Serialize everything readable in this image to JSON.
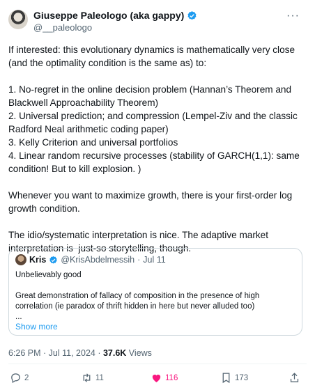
{
  "author": {
    "name": "Giuseppe Paleologo (aka gappy)",
    "handle": "@__paleologo"
  },
  "more_icon": "more-dots-icon",
  "body_text": "If interested: this evolutionary dynamics is mathematically very close\n(and the optimality condition is the same as) to:\n\n1. No-regret in the online decision problem (Hannan’s Theorem and\nBlackwell Approachability Theorem)\n2. Universal prediction; and compression (Lempel-Ziv and the classic\nRadford Neal arithmetic coding paper)\n3. Kelly Criterion and universal portfolios\n4. Linear random recursive processes (stability of GARCH(1,1): same\ncondition! But to kill explosion. )\n\nWhenever you want to maximize growth, there is your first-order log\ngrowth condition.\n\nThe idio/systematic interpretation is nice. The adaptive market\ninterpretation is  just-so storytelling, though.",
  "quote": {
    "name": "Kris",
    "handle": "@KrisAbdelmessih",
    "separator": "·",
    "date": "Jul 11",
    "text": "Unbelievably good\n\nGreat demonstration of fallacy of composition in the presence of high\ncorrelation (ie paradox of thrift hidden in here but never alluded too)\n...",
    "show_more": "Show more"
  },
  "meta": {
    "time": "6:26 PM",
    "dot1": " · ",
    "date": "Jul 11, 2024",
    "dot2": " · ",
    "views_count": "37.6K",
    "views_label": " Views"
  },
  "actions": {
    "replies": "2",
    "reposts": "11",
    "likes": "116",
    "bookmarks": "173",
    "like_color": "#f91880"
  },
  "colors": {
    "accent": "#1d9bf0",
    "secondary": "#536471"
  }
}
